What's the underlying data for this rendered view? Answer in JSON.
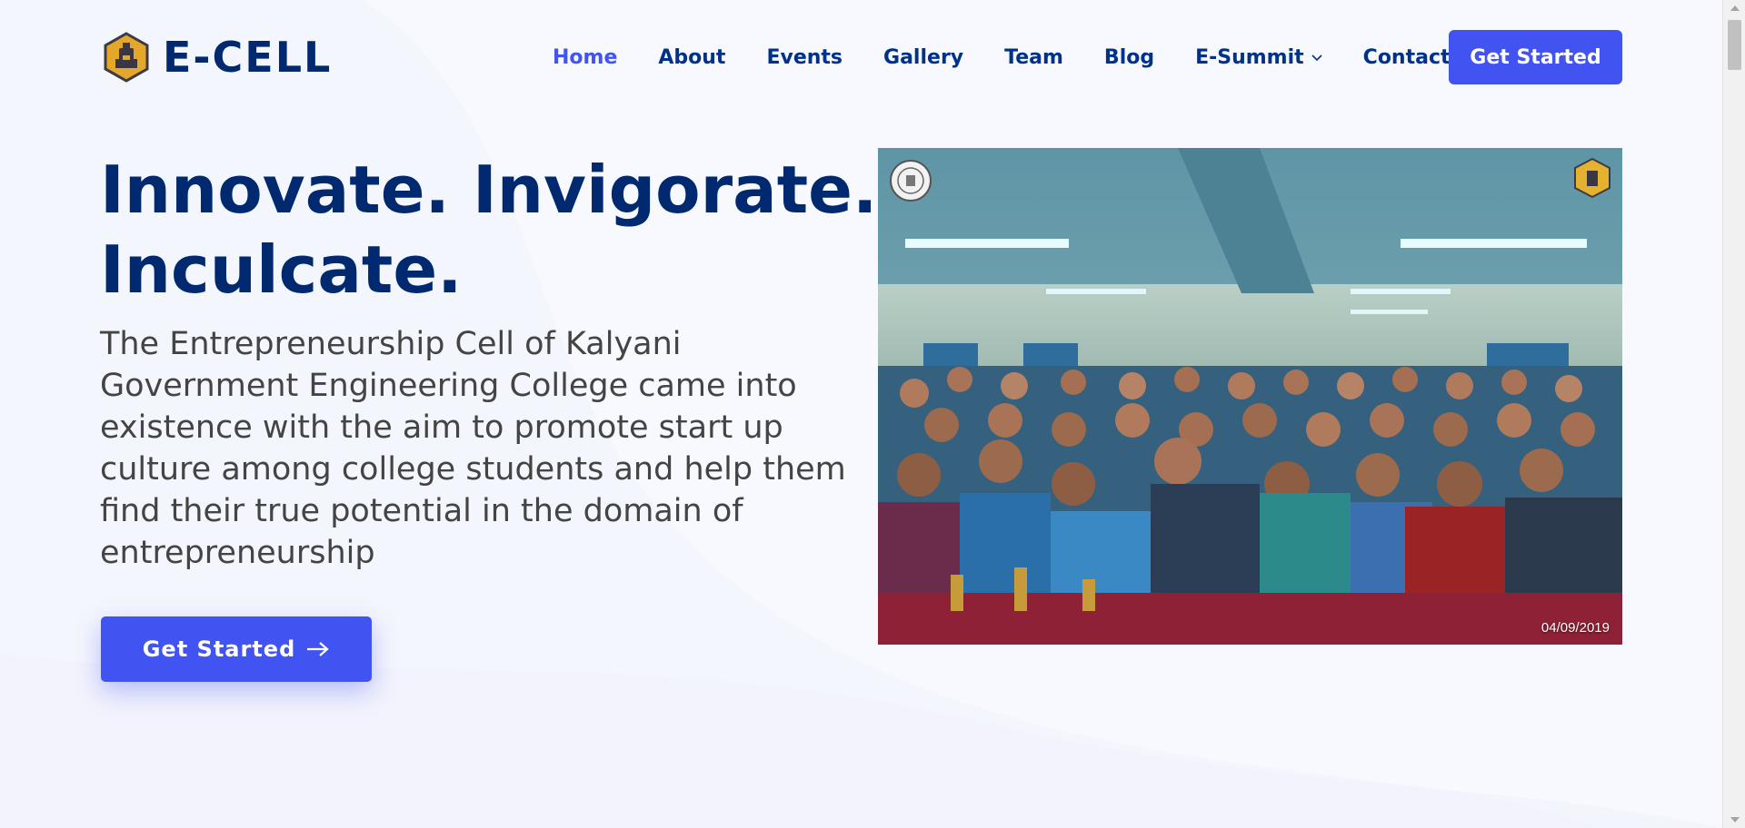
{
  "brand": {
    "name": "E-CELL",
    "logo_icon": "ecell-hexagon-logo",
    "primary_color": "#012970",
    "accent_color": "#4154f1"
  },
  "nav": {
    "items": [
      {
        "label": "Home",
        "active": true
      },
      {
        "label": "About"
      },
      {
        "label": "Events"
      },
      {
        "label": "Gallery"
      },
      {
        "label": "Team"
      },
      {
        "label": "Blog"
      },
      {
        "label": "E-Summit",
        "dropdown": true
      },
      {
        "label": "Contact"
      }
    ],
    "cta_label": "Get Started"
  },
  "hero": {
    "title_line1": "Innovate. Invigorate.",
    "title_line2": "Inculcate.",
    "description": "The Entrepreneurship Cell of Kalyani Government Engineering College came into existence with the aim to promote start up culture among college students and help them find their true potential in the domain of entrepreneurship",
    "cta_label": "Get Started",
    "cta_icon": "arrow-right-icon",
    "image": {
      "subject": "group-photo-students",
      "date_stamp": "04/09/2019"
    }
  }
}
